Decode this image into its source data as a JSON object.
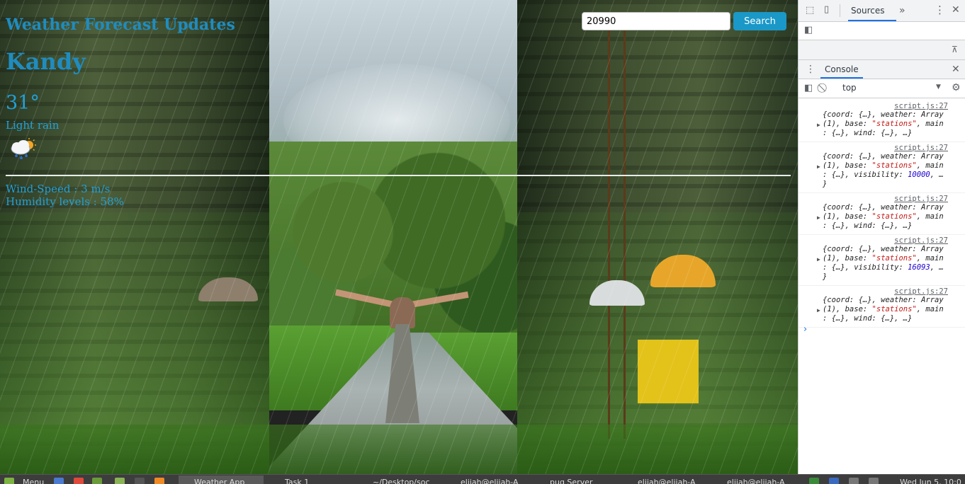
{
  "app": {
    "title": "Weather Forecast Updates",
    "city": "Kandy",
    "temperature": "31°",
    "description": "Light rain",
    "weather_icon": "rain-cloud-sun-icon",
    "wind": "Wind-Speed : 3 m/s",
    "humidity": "Humidity levels : 58%",
    "search": {
      "value": "20990",
      "button_label": "Search"
    }
  },
  "devtools": {
    "top_tab": "Sources",
    "drawer_tab": "Console",
    "context": "top",
    "logs": [
      {
        "source": "script.js:27",
        "lines": [
          "{coord: {…}, weather: Array",
          "(1), base: \"stations\", main",
          ": {…}, wind: {…}, …}"
        ]
      },
      {
        "source": "script.js:27",
        "lines": [
          "{coord: {…}, weather: Array",
          "(1), base: \"stations\", main",
          ": {…}, visibility: 10000, …",
          "}"
        ]
      },
      {
        "source": "script.js:27",
        "lines": [
          "{coord: {…}, weather: Array",
          "(1), base: \"stations\", main",
          ": {…}, wind: {…}, …}"
        ]
      },
      {
        "source": "script.js:27",
        "lines": [
          "{coord: {…}, weather: Array",
          "(1), base: \"stations\", main",
          ": {…}, visibility: 16093, …",
          "}"
        ]
      },
      {
        "source": "script.js:27",
        "lines": [
          "{coord: {…}, weather: Array",
          "(1), base: \"stations\", main",
          ": {…}, wind: {…}, …}"
        ]
      }
    ]
  },
  "taskbar": {
    "menu": "Menu",
    "items": [
      "Weather App",
      "Task 1",
      "~/Desktop/soc",
      "elijah@elijah-A",
      "pug Server",
      "elijah@elijah-A",
      "elijah@elijah-A"
    ],
    "clock": "Wed Jun  5, 10:0"
  },
  "colors": {
    "accent": "#1f8cc0",
    "search_button": "#1a98c8",
    "devtools_accent": "#1a73e8"
  }
}
